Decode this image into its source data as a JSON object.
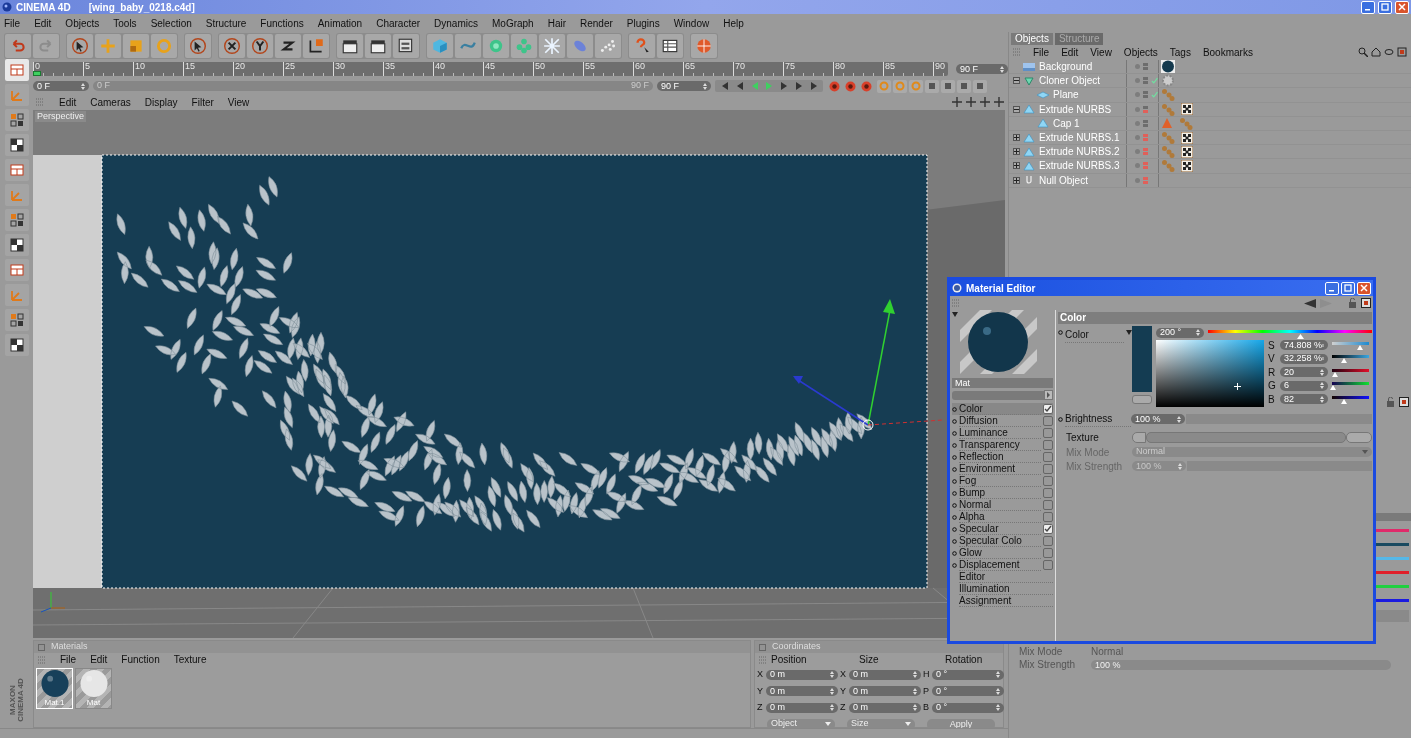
{
  "window": {
    "app": "CINEMA 4D",
    "document": "[wing_baby_0218.c4d]"
  },
  "menu": [
    "File",
    "Edit",
    "Objects",
    "Tools",
    "Selection",
    "Structure",
    "Functions",
    "Animation",
    "Character",
    "Dynamics",
    "MoGraph",
    "Hair",
    "Render",
    "Plugins",
    "Window",
    "Help"
  ],
  "timeline": {
    "ticks": [
      "0",
      "5",
      "10",
      "15",
      "20",
      "25",
      "30",
      "35",
      "40",
      "45",
      "50",
      "55",
      "60",
      "65",
      "70",
      "75",
      "80",
      "85",
      "90"
    ],
    "level": 0,
    "end_field": "90 F",
    "current_frame": "0 F",
    "slider_value": "0 F",
    "slider_end": "90 F",
    "max_field": "90 F"
  },
  "viewport": {
    "menu": [
      "Edit",
      "Cameras",
      "Display",
      "Filter",
      "View"
    ],
    "label": "Perspective"
  },
  "object_manager": {
    "tabs": [
      {
        "label": "Objects",
        "selected": true
      },
      {
        "label": "Structure",
        "selected": false
      }
    ],
    "menu": [
      "File",
      "Edit",
      "View",
      "Objects",
      "Tags",
      "Bookmarks"
    ],
    "objects": [
      {
        "name": "Background",
        "kind": "background",
        "editor_hidden": false,
        "render_hidden": false,
        "checked": false,
        "tags": [
          {
            "kind": "material"
          }
        ]
      },
      {
        "name": "Cloner Object",
        "kind": "cloner",
        "expanded": true,
        "editor_hidden": false,
        "render_hidden": false,
        "checked": true,
        "tags": [
          {
            "kind": "gear"
          }
        ],
        "children": [
          {
            "name": "Plane",
            "kind": "plane",
            "editor_hidden": false,
            "render_hidden": false,
            "checked": true,
            "tags": [
              {
                "kind": "phong"
              }
            ]
          }
        ]
      },
      {
        "name": "Extrude NURBS",
        "kind": "nurbs",
        "expanded": true,
        "editor_hidden": false,
        "render_hidden": true,
        "checked": false,
        "tags": [
          {
            "kind": "phong"
          },
          {
            "kind": "texture"
          }
        ],
        "children": [
          {
            "name": "Cap 1",
            "kind": "nurbs",
            "editor_hidden": false,
            "render_hidden": false,
            "checked": false,
            "tags": [
              {
                "kind": "warning"
              },
              {
                "kind": "phong"
              }
            ]
          }
        ]
      },
      {
        "name": "Extrude NURBS.1",
        "kind": "nurbs",
        "expanded": false,
        "editor_hidden": true,
        "render_hidden": true,
        "checked": false,
        "tags": [
          {
            "kind": "phong"
          },
          {
            "kind": "texture"
          }
        ]
      },
      {
        "name": "Extrude NURBS.2",
        "kind": "nurbs",
        "expanded": false,
        "editor_hidden": true,
        "render_hidden": true,
        "checked": false,
        "tags": [
          {
            "kind": "phong"
          },
          {
            "kind": "texture"
          }
        ]
      },
      {
        "name": "Extrude NURBS.3",
        "kind": "nurbs",
        "expanded": false,
        "editor_hidden": true,
        "render_hidden": true,
        "checked": false,
        "tags": [
          {
            "kind": "phong"
          },
          {
            "kind": "texture"
          }
        ]
      },
      {
        "name": "Null Object",
        "kind": "null",
        "expanded": false,
        "editor_hidden": true,
        "render_hidden": true,
        "checked": false
      }
    ]
  },
  "material_editor": {
    "title": "Material Editor",
    "material_name": "Mat",
    "channels": [
      {
        "label": "Color",
        "kind": "channel",
        "checked": true,
        "selected": true
      },
      {
        "label": "Diffusion",
        "kind": "channel",
        "checked": false,
        "selected": false
      },
      {
        "label": "Luminance",
        "kind": "channel",
        "checked": false,
        "selected": false
      },
      {
        "label": "Transparency",
        "kind": "channel",
        "checked": false,
        "selected": false
      },
      {
        "label": "Reflection",
        "kind": "channel",
        "checked": false,
        "selected": false
      },
      {
        "label": "Environment",
        "kind": "channel",
        "checked": false,
        "selected": false
      },
      {
        "label": "Fog",
        "kind": "channel",
        "checked": false,
        "selected": false
      },
      {
        "label": "Bump",
        "kind": "channel",
        "checked": false,
        "selected": false
      },
      {
        "label": "Normal",
        "kind": "channel",
        "checked": false,
        "selected": false
      },
      {
        "label": "Alpha",
        "kind": "channel",
        "checked": false,
        "selected": false
      },
      {
        "label": "Specular",
        "kind": "channel",
        "checked": true,
        "selected": false
      },
      {
        "label": "Specular Colo",
        "kind": "channel",
        "checked": false,
        "selected": false
      },
      {
        "label": "Glow",
        "kind": "channel",
        "checked": false,
        "selected": false
      },
      {
        "label": "Displacement",
        "kind": "channel",
        "checked": false,
        "selected": false
      },
      {
        "label": "Editor",
        "kind": "page",
        "selected": false
      },
      {
        "label": "Illumination",
        "kind": "page",
        "selected": false
      },
      {
        "label": "Assignment",
        "kind": "page",
        "selected": false
      }
    ],
    "section": "Color",
    "color_label": "Color",
    "hue": {
      "value": "200 °",
      "level": 0.56
    },
    "sliders": [
      {
        "label": "S",
        "value": "74.808 %",
        "kind": "saturation",
        "level": 0.75
      },
      {
        "label": "V",
        "value": "32.258 %",
        "kind": "brightness",
        "level": 0.32
      },
      {
        "label": "R",
        "value": "20",
        "kind": "red",
        "level": 0.08
      },
      {
        "label": "G",
        "value": "6",
        "kind": "green",
        "level": 0.03
      },
      {
        "label": "B",
        "value": "82",
        "kind": "blue",
        "level": 0.32
      }
    ],
    "brightness_label": "Brightness",
    "brightness_value": "100 %",
    "texture_label": "Texture",
    "mix_mode_label": "Mix Mode",
    "mix_mode_value": "Normal",
    "mix_strength_label": "Mix Strength",
    "mix_strength_value": "100 %"
  },
  "attributes": {
    "mix_mode_label": "Mix Mode",
    "mix_mode_value": "Normal",
    "mix_strength_label": "Mix Strength",
    "mix_strength_value": "100 %"
  },
  "materials": {
    "title": "Materials",
    "menu": [
      "File",
      "Edit",
      "Function",
      "Texture"
    ],
    "items": [
      {
        "name": "Mat.1",
        "kind": "dark",
        "selected": true
      },
      {
        "name": "Mat",
        "kind": "white",
        "selected": false
      }
    ]
  },
  "coordinates": {
    "title": "Coordinates",
    "headers": [
      "Position",
      "Size",
      "Rotation"
    ],
    "rows": [
      [
        {
          "axis": "X",
          "value": "0 m"
        },
        {
          "axis": "X",
          "value": "0 m"
        },
        {
          "axis": "H",
          "value": "0 °"
        }
      ],
      [
        {
          "axis": "Y",
          "value": "0 m"
        },
        {
          "axis": "Y",
          "value": "0 m"
        },
        {
          "axis": "P",
          "value": "0 °"
        }
      ],
      [
        {
          "axis": "Z",
          "value": "0 m"
        },
        {
          "axis": "Z",
          "value": "0 m"
        },
        {
          "axis": "B",
          "value": "0 °"
        }
      ]
    ],
    "dropdowns": [
      "Object",
      "Size"
    ],
    "apply": "Apply"
  },
  "logo": [
    "MAXON",
    "CINEMA 4D"
  ]
}
